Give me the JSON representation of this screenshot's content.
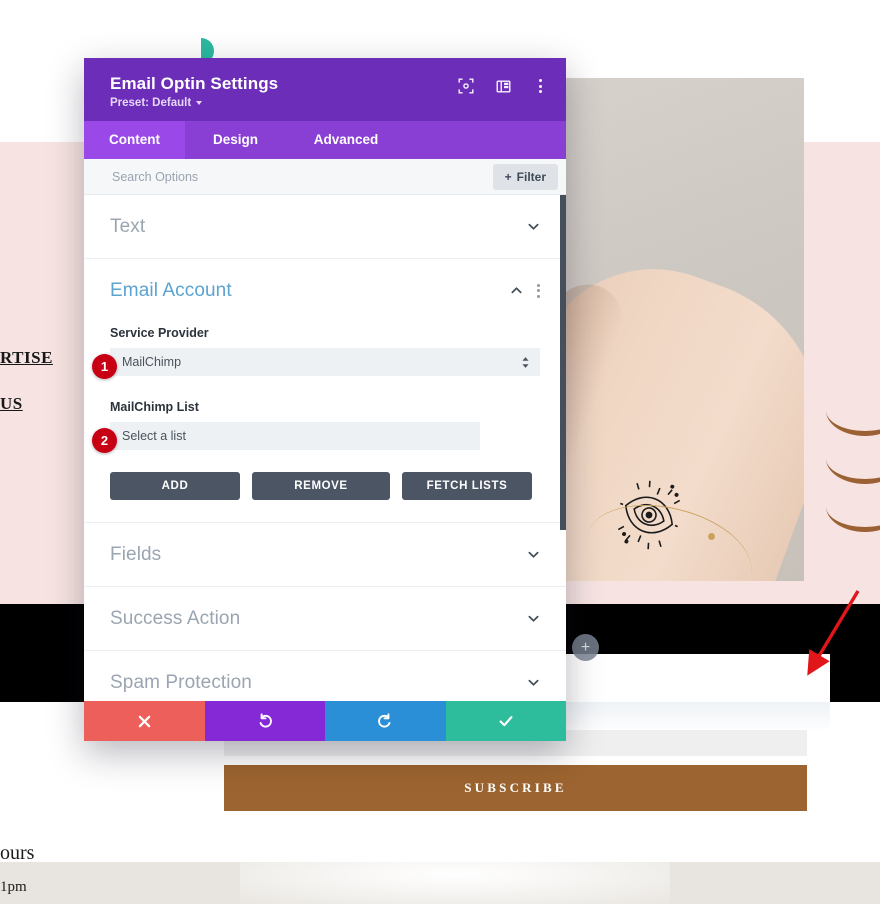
{
  "modal": {
    "title": "Email Optin Settings",
    "preset": "Preset: Default",
    "icons": {
      "focus": "focus-target-icon",
      "layout": "layout-panel-icon",
      "menu": "vertical-dots-icon"
    },
    "tabs": [
      {
        "label": "Content",
        "active": true
      },
      {
        "label": "Design",
        "active": false
      },
      {
        "label": "Advanced",
        "active": false
      }
    ],
    "search": {
      "placeholder": "Search Options",
      "value": ""
    },
    "filter_button": {
      "label": "Filter",
      "icon": "plus-icon"
    },
    "sections": [
      {
        "name": "text",
        "title": "Text",
        "open": false,
        "chevron": "chevron-down-icon"
      },
      {
        "name": "email-account",
        "title": "Email Account",
        "open": true,
        "chevron": "chevron-up-icon",
        "menu_icon": "vertical-dots-icon",
        "fields": [
          {
            "label": "Service Provider",
            "value": "MailChimp",
            "badge": "1",
            "control": "select"
          },
          {
            "label": "MailChimp List",
            "value": "Select a list",
            "badge": "2",
            "control": "select"
          }
        ],
        "buttons": [
          {
            "label": "ADD",
            "name": "add-button"
          },
          {
            "label": "REMOVE",
            "name": "remove-button"
          },
          {
            "label": "FETCH LISTS",
            "name": "fetch-lists-button"
          }
        ]
      },
      {
        "name": "fields",
        "title": "Fields",
        "open": false,
        "chevron": "chevron-down-icon"
      },
      {
        "name": "success-action",
        "title": "Success Action",
        "open": false,
        "chevron": "chevron-down-icon"
      },
      {
        "name": "spam-protection",
        "title": "Spam Protection",
        "open": false,
        "chevron": "chevron-down-icon"
      }
    ],
    "footer": [
      {
        "name": "cancel-button",
        "icon": "close-x-icon",
        "glyph": "✖",
        "color": "#ec5f5a"
      },
      {
        "name": "undo-button",
        "icon": "undo-arrow-icon",
        "glyph": "↺",
        "color": "#8528d6"
      },
      {
        "name": "redo-button",
        "icon": "redo-arrow-icon",
        "glyph": "↻",
        "color": "#2b8fd8"
      },
      {
        "name": "save-button",
        "icon": "checkmark-icon",
        "glyph": "✔",
        "color": "#2ebd9c"
      }
    ]
  },
  "page": {
    "nav_links": [
      "RTISE",
      "US"
    ],
    "hours": {
      "title": "ours",
      "time": "1pm"
    },
    "optin": {
      "email_placeholder": "",
      "subscribe_label": "SUBSCRIBE"
    },
    "add_module_icon": "plus-circle-icon",
    "logo_icon": "divi-logo-icon"
  },
  "annotation": {
    "arrow": "red-pointer-arrow",
    "color": "#e0161a"
  },
  "colors": {
    "modal_header": "#6c2eb9",
    "modal_tabs": "#8a3fd4",
    "active_tab": "#9a49e8",
    "badge": "#c70014",
    "button_grey": "#4b5563",
    "section_open_title": "#5ba3d0",
    "subscribe": "#9c6430",
    "band_pink": "#f7e4e2"
  }
}
